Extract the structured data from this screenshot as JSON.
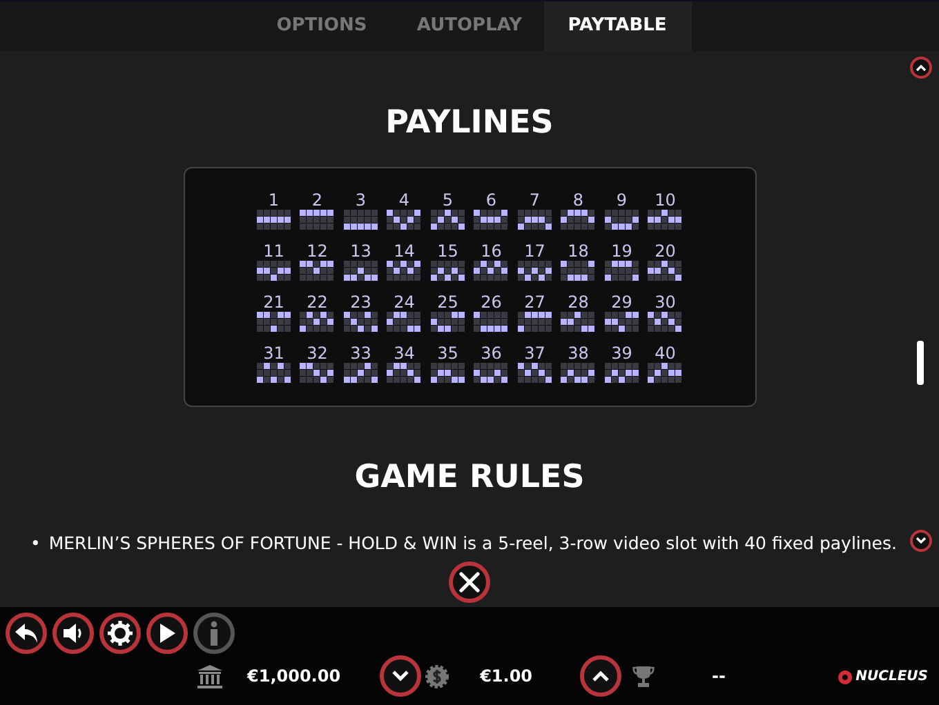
{
  "tabs": [
    {
      "label": "OPTIONS",
      "selected": false
    },
    {
      "label": "AUTOPLAY",
      "selected": false
    },
    {
      "label": "PAYTABLE",
      "selected": true
    }
  ],
  "paylines": {
    "title": "PAYLINES",
    "lines": [
      {
        "number": "1",
        "rows": [
          [
            false,
            false,
            false,
            false,
            false
          ],
          [
            true,
            true,
            true,
            true,
            true
          ],
          [
            false,
            false,
            false,
            false,
            false
          ]
        ]
      },
      {
        "number": "2",
        "rows": [
          [
            true,
            true,
            true,
            true,
            true
          ],
          [
            false,
            false,
            false,
            false,
            false
          ],
          [
            false,
            false,
            false,
            false,
            false
          ]
        ]
      },
      {
        "number": "3",
        "rows": [
          [
            false,
            false,
            false,
            false,
            false
          ],
          [
            false,
            false,
            false,
            false,
            false
          ],
          [
            true,
            true,
            true,
            true,
            true
          ]
        ]
      },
      {
        "number": "4",
        "rows": [
          [
            true,
            false,
            false,
            false,
            true
          ],
          [
            false,
            true,
            false,
            true,
            false
          ],
          [
            false,
            false,
            true,
            false,
            false
          ]
        ]
      },
      {
        "number": "5",
        "rows": [
          [
            false,
            false,
            true,
            false,
            false
          ],
          [
            false,
            true,
            false,
            true,
            false
          ],
          [
            true,
            false,
            false,
            false,
            true
          ]
        ]
      },
      {
        "number": "6",
        "rows": [
          [
            true,
            false,
            false,
            false,
            true
          ],
          [
            false,
            true,
            true,
            true,
            false
          ],
          [
            false,
            false,
            false,
            false,
            false
          ]
        ]
      },
      {
        "number": "7",
        "rows": [
          [
            false,
            false,
            false,
            false,
            false
          ],
          [
            false,
            true,
            true,
            true,
            false
          ],
          [
            true,
            false,
            false,
            false,
            true
          ]
        ]
      },
      {
        "number": "8",
        "rows": [
          [
            false,
            true,
            true,
            true,
            false
          ],
          [
            true,
            false,
            false,
            false,
            true
          ],
          [
            false,
            false,
            false,
            false,
            false
          ]
        ]
      },
      {
        "number": "9",
        "rows": [
          [
            false,
            false,
            false,
            false,
            false
          ],
          [
            true,
            false,
            false,
            false,
            true
          ],
          [
            false,
            true,
            true,
            true,
            false
          ]
        ]
      },
      {
        "number": "10",
        "rows": [
          [
            false,
            false,
            true,
            false,
            false
          ],
          [
            true,
            true,
            false,
            true,
            true
          ],
          [
            false,
            false,
            false,
            false,
            false
          ]
        ]
      },
      {
        "number": "11",
        "rows": [
          [
            false,
            false,
            false,
            false,
            false
          ],
          [
            true,
            true,
            false,
            true,
            true
          ],
          [
            false,
            false,
            true,
            false,
            false
          ]
        ]
      },
      {
        "number": "12",
        "rows": [
          [
            true,
            true,
            false,
            true,
            true
          ],
          [
            false,
            false,
            true,
            false,
            false
          ],
          [
            false,
            false,
            false,
            false,
            false
          ]
        ]
      },
      {
        "number": "13",
        "rows": [
          [
            false,
            false,
            false,
            false,
            false
          ],
          [
            false,
            false,
            true,
            false,
            false
          ],
          [
            true,
            true,
            false,
            true,
            true
          ]
        ]
      },
      {
        "number": "14",
        "rows": [
          [
            true,
            false,
            true,
            false,
            true
          ],
          [
            false,
            true,
            false,
            true,
            false
          ],
          [
            false,
            false,
            false,
            false,
            false
          ]
        ]
      },
      {
        "number": "15",
        "rows": [
          [
            false,
            false,
            false,
            false,
            false
          ],
          [
            false,
            true,
            false,
            true,
            false
          ],
          [
            true,
            false,
            true,
            false,
            true
          ]
        ]
      },
      {
        "number": "16",
        "rows": [
          [
            false,
            true,
            false,
            true,
            false
          ],
          [
            true,
            false,
            true,
            false,
            true
          ],
          [
            false,
            false,
            false,
            false,
            false
          ]
        ]
      },
      {
        "number": "17",
        "rows": [
          [
            false,
            false,
            false,
            false,
            false
          ],
          [
            true,
            false,
            true,
            false,
            true
          ],
          [
            false,
            true,
            false,
            true,
            false
          ]
        ]
      },
      {
        "number": "18",
        "rows": [
          [
            true,
            false,
            false,
            false,
            true
          ],
          [
            false,
            false,
            false,
            false,
            false
          ],
          [
            false,
            true,
            true,
            true,
            false
          ]
        ]
      },
      {
        "number": "19",
        "rows": [
          [
            false,
            true,
            true,
            true,
            false
          ],
          [
            false,
            false,
            false,
            false,
            false
          ],
          [
            true,
            false,
            false,
            false,
            true
          ]
        ]
      },
      {
        "number": "20",
        "rows": [
          [
            false,
            false,
            true,
            false,
            false
          ],
          [
            true,
            true,
            false,
            true,
            false
          ],
          [
            false,
            false,
            false,
            false,
            true
          ]
        ]
      },
      {
        "number": "21",
        "rows": [
          [
            true,
            true,
            false,
            true,
            true
          ],
          [
            false,
            false,
            false,
            false,
            false
          ],
          [
            false,
            false,
            true,
            false,
            false
          ]
        ]
      },
      {
        "number": "22",
        "rows": [
          [
            false,
            true,
            false,
            true,
            false
          ],
          [
            false,
            false,
            true,
            false,
            true
          ],
          [
            true,
            false,
            false,
            false,
            false
          ]
        ]
      },
      {
        "number": "23",
        "rows": [
          [
            true,
            false,
            false,
            true,
            false
          ],
          [
            false,
            true,
            false,
            false,
            false
          ],
          [
            false,
            false,
            true,
            false,
            true
          ]
        ]
      },
      {
        "number": "24",
        "rows": [
          [
            false,
            true,
            true,
            false,
            false
          ],
          [
            true,
            false,
            false,
            false,
            false
          ],
          [
            false,
            false,
            false,
            true,
            true
          ]
        ]
      },
      {
        "number": "25",
        "rows": [
          [
            false,
            false,
            false,
            true,
            true
          ],
          [
            true,
            false,
            false,
            false,
            false
          ],
          [
            false,
            true,
            true,
            false,
            false
          ]
        ]
      },
      {
        "number": "26",
        "rows": [
          [
            true,
            false,
            false,
            false,
            false
          ],
          [
            false,
            false,
            false,
            false,
            false
          ],
          [
            false,
            true,
            true,
            true,
            true
          ]
        ]
      },
      {
        "number": "27",
        "rows": [
          [
            false,
            true,
            true,
            true,
            true
          ],
          [
            false,
            false,
            false,
            false,
            false
          ],
          [
            true,
            false,
            false,
            false,
            false
          ]
        ]
      },
      {
        "number": "28",
        "rows": [
          [
            false,
            false,
            true,
            false,
            false
          ],
          [
            true,
            true,
            false,
            false,
            false
          ],
          [
            false,
            false,
            false,
            true,
            true
          ]
        ]
      },
      {
        "number": "29",
        "rows": [
          [
            false,
            false,
            false,
            true,
            true
          ],
          [
            true,
            true,
            false,
            false,
            false
          ],
          [
            false,
            false,
            true,
            false,
            false
          ]
        ]
      },
      {
        "number": "30",
        "rows": [
          [
            true,
            false,
            true,
            false,
            false
          ],
          [
            false,
            true,
            false,
            true,
            false
          ],
          [
            false,
            false,
            false,
            false,
            true
          ]
        ]
      },
      {
        "number": "31",
        "rows": [
          [
            false,
            true,
            false,
            true,
            false
          ],
          [
            false,
            false,
            false,
            false,
            false
          ],
          [
            true,
            false,
            true,
            false,
            true
          ]
        ]
      },
      {
        "number": "32",
        "rows": [
          [
            true,
            true,
            false,
            false,
            false
          ],
          [
            false,
            false,
            true,
            false,
            true
          ],
          [
            false,
            false,
            false,
            true,
            false
          ]
        ]
      },
      {
        "number": "33",
        "rows": [
          [
            false,
            false,
            false,
            true,
            false
          ],
          [
            false,
            false,
            true,
            false,
            false
          ],
          [
            true,
            true,
            false,
            false,
            true
          ]
        ]
      },
      {
        "number": "34",
        "rows": [
          [
            false,
            true,
            true,
            false,
            false
          ],
          [
            true,
            false,
            false,
            true,
            false
          ],
          [
            false,
            false,
            false,
            false,
            true
          ]
        ]
      },
      {
        "number": "35",
        "rows": [
          [
            false,
            false,
            false,
            false,
            false
          ],
          [
            false,
            true,
            true,
            false,
            false
          ],
          [
            true,
            false,
            false,
            true,
            true
          ]
        ]
      },
      {
        "number": "36",
        "rows": [
          [
            false,
            false,
            false,
            false,
            false
          ],
          [
            true,
            false,
            false,
            true,
            false
          ],
          [
            false,
            true,
            true,
            false,
            true
          ]
        ]
      },
      {
        "number": "37",
        "rows": [
          [
            true,
            false,
            true,
            false,
            false
          ],
          [
            false,
            true,
            false,
            true,
            false
          ],
          [
            false,
            false,
            false,
            false,
            true
          ]
        ]
      },
      {
        "number": "38",
        "rows": [
          [
            false,
            false,
            false,
            false,
            false
          ],
          [
            false,
            true,
            false,
            false,
            true
          ],
          [
            true,
            false,
            true,
            true,
            false
          ]
        ]
      },
      {
        "number": "39",
        "rows": [
          [
            false,
            false,
            false,
            false,
            false
          ],
          [
            false,
            true,
            false,
            true,
            true
          ],
          [
            true,
            false,
            true,
            false,
            false
          ]
        ]
      },
      {
        "number": "40",
        "rows": [
          [
            false,
            false,
            true,
            false,
            false
          ],
          [
            false,
            true,
            false,
            true,
            true
          ],
          [
            true,
            false,
            false,
            false,
            false
          ]
        ]
      }
    ]
  },
  "rules": {
    "title": "GAME RULES",
    "items": [
      {
        "bullet": "•",
        "text": "MERLIN’S SPHERES OF FORTUNE - HOLD & WIN is a 5-reel, 3-row video slot with 40 fixed paylines."
      }
    ]
  },
  "controls": [
    {
      "kind": "back",
      "disabled": false
    },
    {
      "kind": "sound",
      "disabled": false
    },
    {
      "kind": "settings",
      "disabled": false
    },
    {
      "kind": "autoplay",
      "disabled": false
    },
    {
      "kind": "info",
      "disabled": true
    }
  ],
  "status": {
    "balance": "€1,000.00",
    "bet": "€1.00",
    "win": "--"
  },
  "brand": "NUCLEUS"
}
